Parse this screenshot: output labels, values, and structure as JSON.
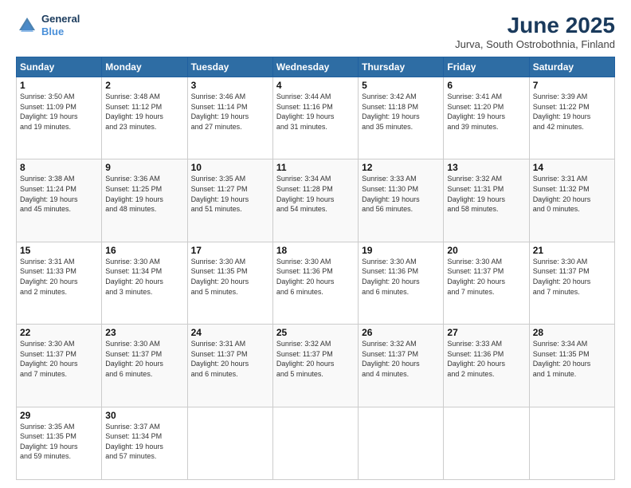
{
  "header": {
    "logo_line1": "General",
    "logo_line2": "Blue",
    "month_title": "June 2025",
    "location": "Jurva, South Ostrobothnia, Finland"
  },
  "days_of_week": [
    "Sunday",
    "Monday",
    "Tuesday",
    "Wednesday",
    "Thursday",
    "Friday",
    "Saturday"
  ],
  "weeks": [
    [
      {
        "day": "1",
        "text": "Sunrise: 3:50 AM\nSunset: 11:09 PM\nDaylight: 19 hours\nand 19 minutes."
      },
      {
        "day": "2",
        "text": "Sunrise: 3:48 AM\nSunset: 11:12 PM\nDaylight: 19 hours\nand 23 minutes."
      },
      {
        "day": "3",
        "text": "Sunrise: 3:46 AM\nSunset: 11:14 PM\nDaylight: 19 hours\nand 27 minutes."
      },
      {
        "day": "4",
        "text": "Sunrise: 3:44 AM\nSunset: 11:16 PM\nDaylight: 19 hours\nand 31 minutes."
      },
      {
        "day": "5",
        "text": "Sunrise: 3:42 AM\nSunset: 11:18 PM\nDaylight: 19 hours\nand 35 minutes."
      },
      {
        "day": "6",
        "text": "Sunrise: 3:41 AM\nSunset: 11:20 PM\nDaylight: 19 hours\nand 39 minutes."
      },
      {
        "day": "7",
        "text": "Sunrise: 3:39 AM\nSunset: 11:22 PM\nDaylight: 19 hours\nand 42 minutes."
      }
    ],
    [
      {
        "day": "8",
        "text": "Sunrise: 3:38 AM\nSunset: 11:24 PM\nDaylight: 19 hours\nand 45 minutes."
      },
      {
        "day": "9",
        "text": "Sunrise: 3:36 AM\nSunset: 11:25 PM\nDaylight: 19 hours\nand 48 minutes."
      },
      {
        "day": "10",
        "text": "Sunrise: 3:35 AM\nSunset: 11:27 PM\nDaylight: 19 hours\nand 51 minutes."
      },
      {
        "day": "11",
        "text": "Sunrise: 3:34 AM\nSunset: 11:28 PM\nDaylight: 19 hours\nand 54 minutes."
      },
      {
        "day": "12",
        "text": "Sunrise: 3:33 AM\nSunset: 11:30 PM\nDaylight: 19 hours\nand 56 minutes."
      },
      {
        "day": "13",
        "text": "Sunrise: 3:32 AM\nSunset: 11:31 PM\nDaylight: 19 hours\nand 58 minutes."
      },
      {
        "day": "14",
        "text": "Sunrise: 3:31 AM\nSunset: 11:32 PM\nDaylight: 20 hours\nand 0 minutes."
      }
    ],
    [
      {
        "day": "15",
        "text": "Sunrise: 3:31 AM\nSunset: 11:33 PM\nDaylight: 20 hours\nand 2 minutes."
      },
      {
        "day": "16",
        "text": "Sunrise: 3:30 AM\nSunset: 11:34 PM\nDaylight: 20 hours\nand 3 minutes."
      },
      {
        "day": "17",
        "text": "Sunrise: 3:30 AM\nSunset: 11:35 PM\nDaylight: 20 hours\nand 5 minutes."
      },
      {
        "day": "18",
        "text": "Sunrise: 3:30 AM\nSunset: 11:36 PM\nDaylight: 20 hours\nand 6 minutes."
      },
      {
        "day": "19",
        "text": "Sunrise: 3:30 AM\nSunset: 11:36 PM\nDaylight: 20 hours\nand 6 minutes."
      },
      {
        "day": "20",
        "text": "Sunrise: 3:30 AM\nSunset: 11:37 PM\nDaylight: 20 hours\nand 7 minutes."
      },
      {
        "day": "21",
        "text": "Sunrise: 3:30 AM\nSunset: 11:37 PM\nDaylight: 20 hours\nand 7 minutes."
      }
    ],
    [
      {
        "day": "22",
        "text": "Sunrise: 3:30 AM\nSunset: 11:37 PM\nDaylight: 20 hours\nand 7 minutes."
      },
      {
        "day": "23",
        "text": "Sunrise: 3:30 AM\nSunset: 11:37 PM\nDaylight: 20 hours\nand 6 minutes."
      },
      {
        "day": "24",
        "text": "Sunrise: 3:31 AM\nSunset: 11:37 PM\nDaylight: 20 hours\nand 6 minutes."
      },
      {
        "day": "25",
        "text": "Sunrise: 3:32 AM\nSunset: 11:37 PM\nDaylight: 20 hours\nand 5 minutes."
      },
      {
        "day": "26",
        "text": "Sunrise: 3:32 AM\nSunset: 11:37 PM\nDaylight: 20 hours\nand 4 minutes."
      },
      {
        "day": "27",
        "text": "Sunrise: 3:33 AM\nSunset: 11:36 PM\nDaylight: 20 hours\nand 2 minutes."
      },
      {
        "day": "28",
        "text": "Sunrise: 3:34 AM\nSunset: 11:35 PM\nDaylight: 20 hours\nand 1 minute."
      }
    ],
    [
      {
        "day": "29",
        "text": "Sunrise: 3:35 AM\nSunset: 11:35 PM\nDaylight: 19 hours\nand 59 minutes."
      },
      {
        "day": "30",
        "text": "Sunrise: 3:37 AM\nSunset: 11:34 PM\nDaylight: 19 hours\nand 57 minutes."
      },
      {
        "day": "",
        "text": ""
      },
      {
        "day": "",
        "text": ""
      },
      {
        "day": "",
        "text": ""
      },
      {
        "day": "",
        "text": ""
      },
      {
        "day": "",
        "text": ""
      }
    ]
  ]
}
